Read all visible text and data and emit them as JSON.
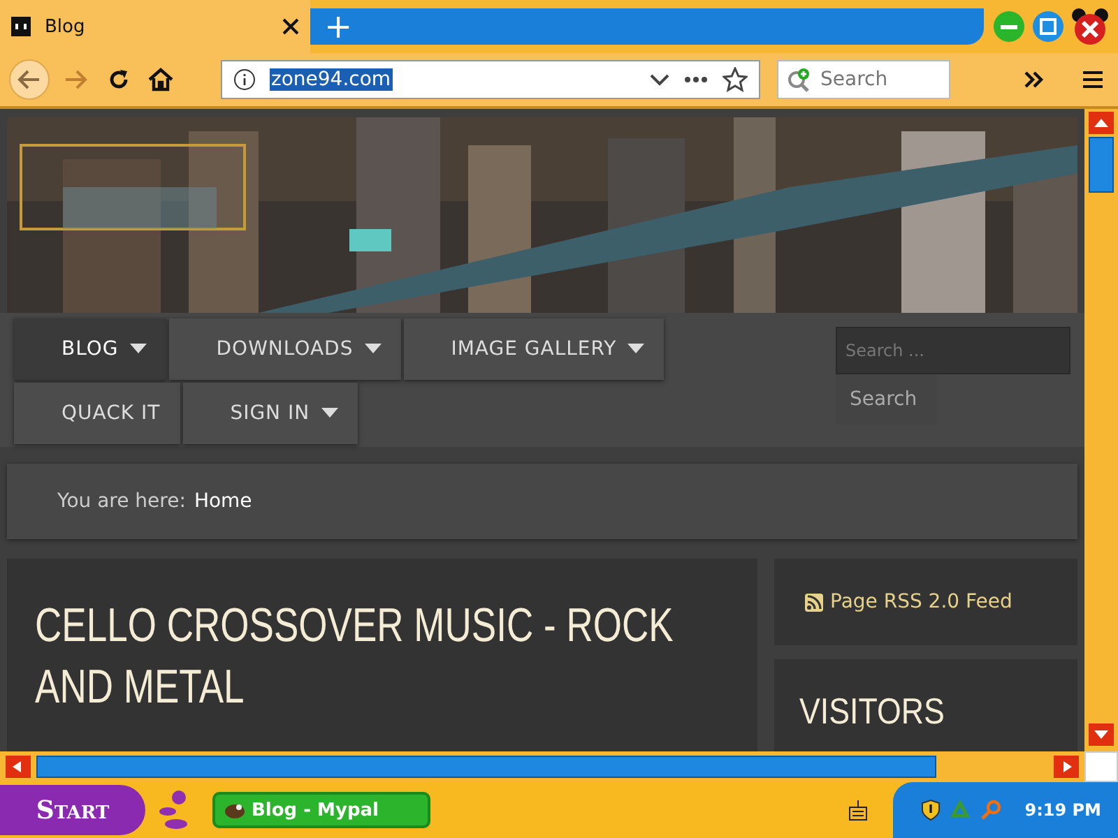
{
  "browser": {
    "tabs": [
      {
        "title": "Blog",
        "selected": true
      }
    ],
    "new_tab": "+",
    "url": "zone94.com",
    "url_selected": true,
    "search": {
      "placeholder": "Search"
    }
  },
  "site": {
    "menu": [
      {
        "label": "BLOG",
        "dropdown": true,
        "selected": true
      },
      {
        "label": "DOWNLOADS",
        "dropdown": true,
        "selected": false
      },
      {
        "label": "IMAGE GALLERY",
        "dropdown": true,
        "selected": false
      },
      {
        "label": "QUACK IT",
        "dropdown": false,
        "selected": false
      },
      {
        "label": "SIGN IN",
        "dropdown": true,
        "selected": false
      }
    ],
    "search": {
      "placeholder": "Search ...",
      "button": "Search"
    },
    "breadcrumb": {
      "label": "You are here:",
      "current": "Home"
    },
    "article": {
      "title": "CELLO CROSSOVER MUSIC - ROCK AND METAL"
    },
    "sidebar": {
      "rss": "Page RSS 2.0 Feed",
      "visitors": "VISITORS"
    }
  },
  "taskbar": {
    "start": "Start",
    "tasks": [
      {
        "title": "Blog - Mypal",
        "selected": true
      }
    ],
    "clock": "9:19 PM"
  }
}
